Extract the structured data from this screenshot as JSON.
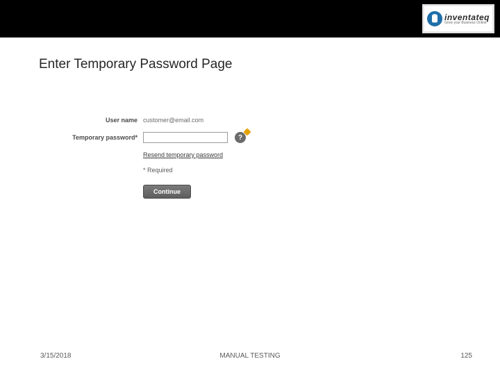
{
  "logo": {
    "word": "inventateq",
    "tagline": "Grow your Business Online"
  },
  "title": "Enter Temporary Password Page",
  "form": {
    "username_label": "User name",
    "username_value": "customer@email.com",
    "temp_pw_label": "Temporary password*",
    "temp_pw_value": "",
    "help_glyph": "?",
    "resend_link": "Resend temporary password",
    "required_note": "* Required",
    "continue_label": "Continue"
  },
  "footer": {
    "date": "3/15/2018",
    "center": "MANUAL TESTING",
    "page": "125"
  }
}
